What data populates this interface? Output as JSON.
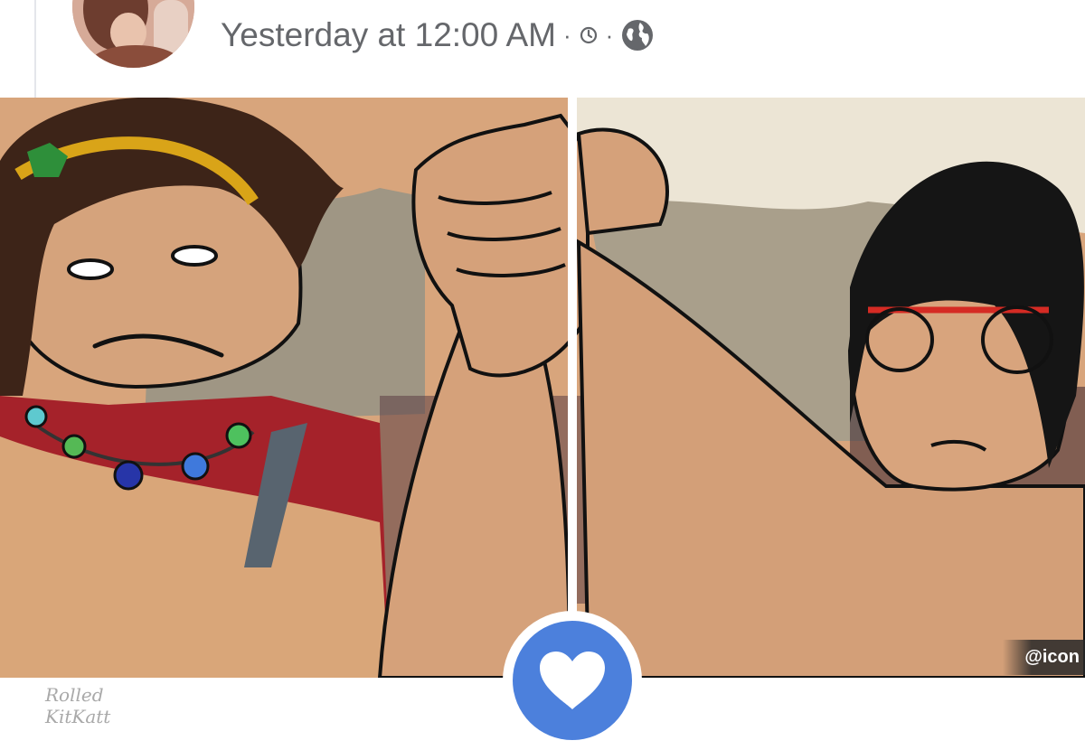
{
  "post": {
    "timestamp": "Yesterday at 12:00 AM",
    "separator": "·",
    "audience_icon": "globe-icon",
    "time_icon": "clock-icon"
  },
  "image": {
    "watermark_line1": "Rolled",
    "watermark_line2": "KitKatt",
    "corner_tag": "@icon"
  },
  "reaction": {
    "icon": "heart-icon",
    "color": "#4c80dc"
  }
}
